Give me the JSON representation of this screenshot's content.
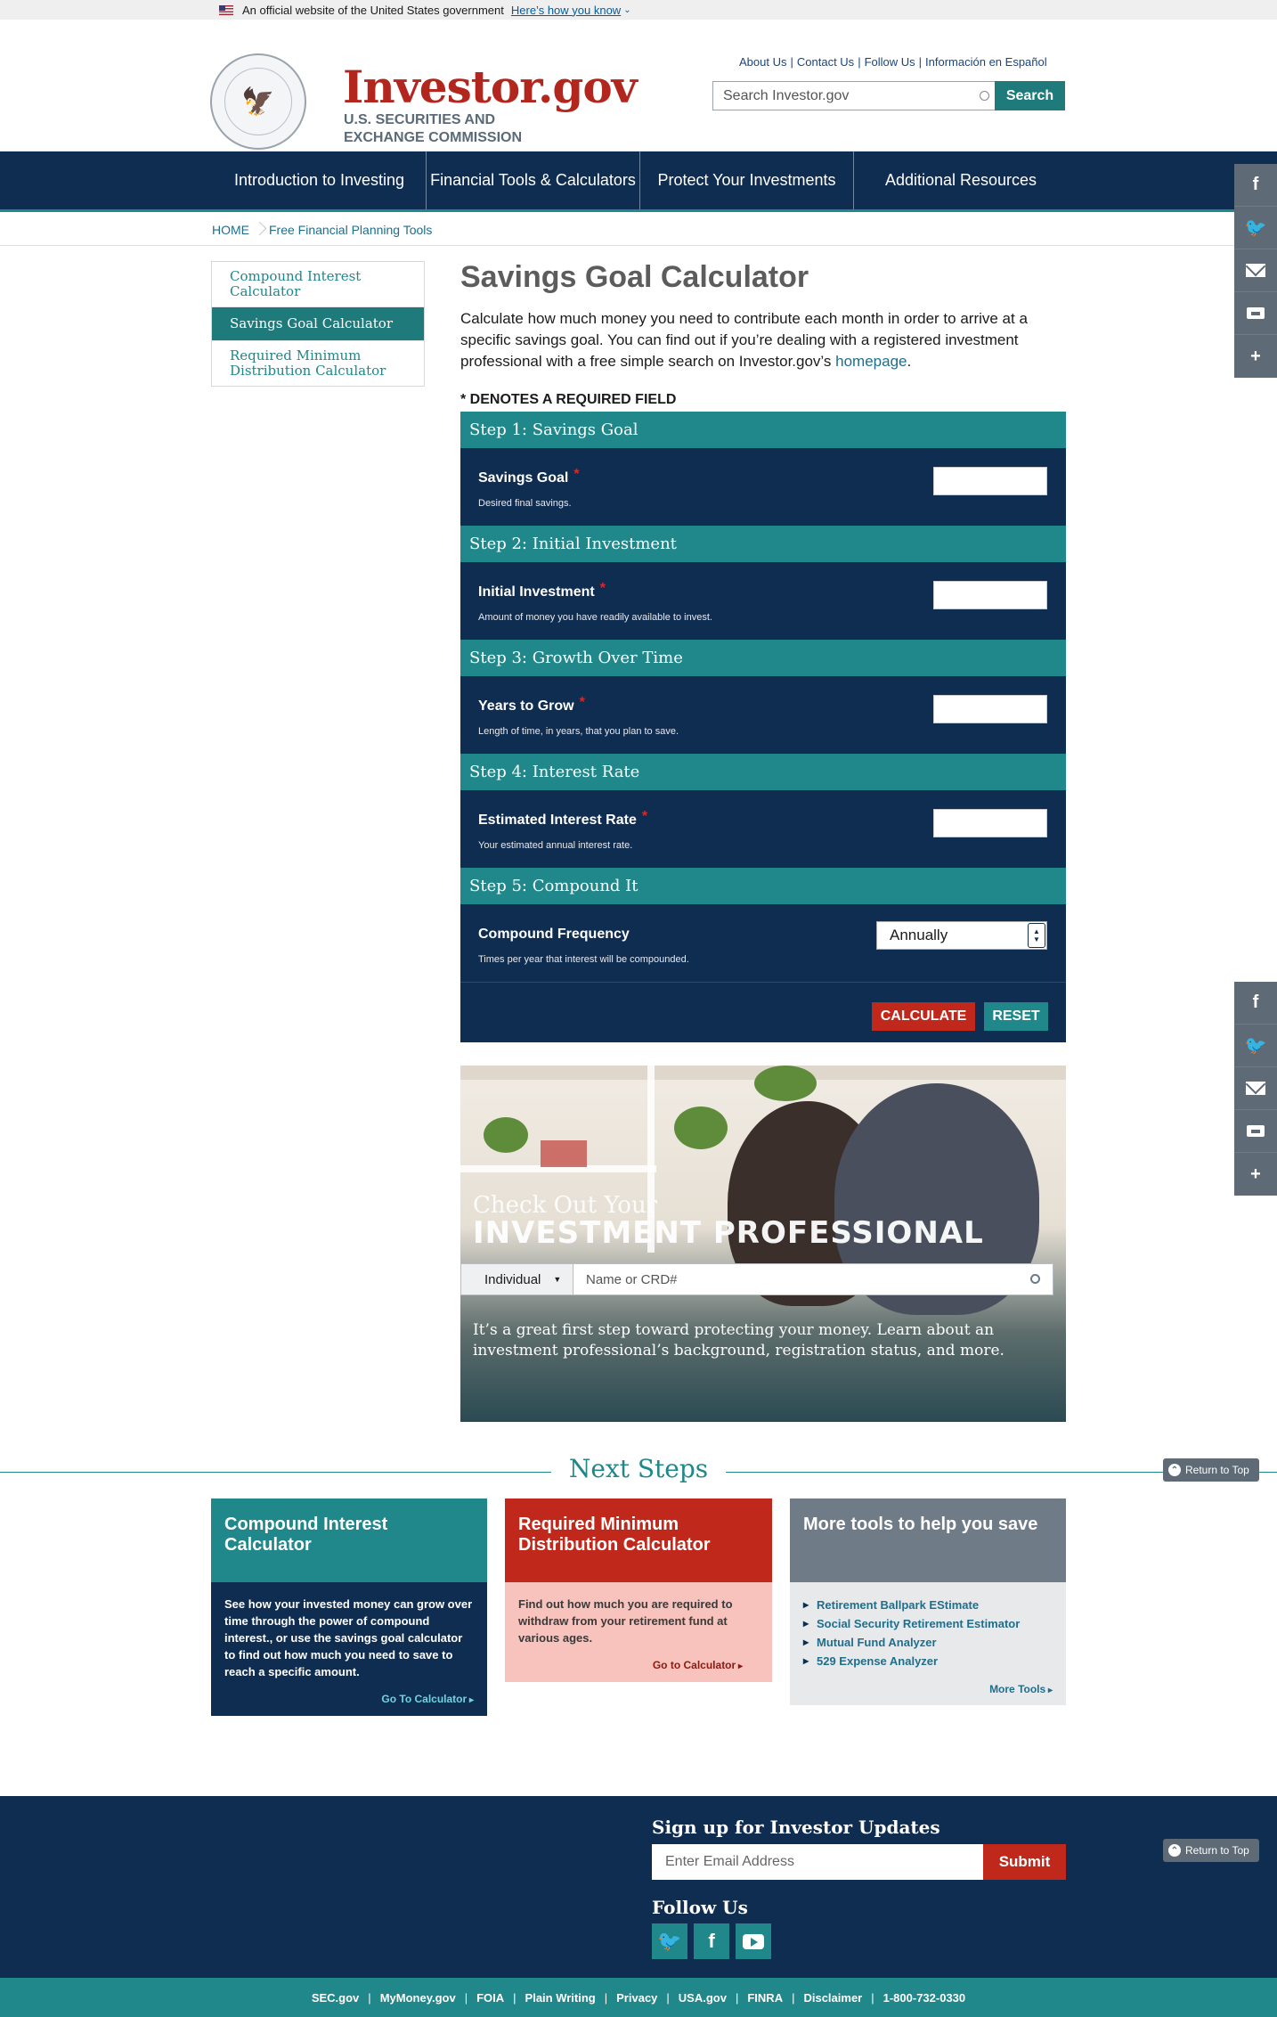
{
  "gov_banner": {
    "text": "An official website of the United States government",
    "link": "Here’s how you know"
  },
  "header": {
    "logo_title": "Investor.gov",
    "logo_subtitle": "U.S. SECURITIES AND EXCHANGE COMMISSION",
    "util_links": [
      "About Us",
      "Contact Us",
      "Follow Us",
      "Información en Español"
    ],
    "search_placeholder": "Search Investor.gov",
    "search_button": "Search"
  },
  "nav": [
    "Introduction to Investing",
    "Financial Tools & Calculators",
    "Protect Your Investments",
    "Additional Resources"
  ],
  "breadcrumb": [
    "HOME",
    "Free Financial Planning Tools"
  ],
  "sidebar": [
    "Compound Interest Calculator",
    "Savings Goal Calculator",
    "Required Minimum Distribution Calculator"
  ],
  "main": {
    "title": "Savings Goal Calculator",
    "intro": "Calculate how much money you need to contribute each month in order to arrive at a specific savings goal. You can find out if you’re dealing with a registered investment professional with a free simple search on Investor.gov’s",
    "intro_link": "homepage",
    "intro_end": ".",
    "required_note": "* DENOTES A REQUIRED FIELD"
  },
  "steps": [
    {
      "heading": "Step 1: Savings Goal",
      "label": "Savings Goal",
      "help": "Desired final savings.",
      "value": ""
    },
    {
      "heading": "Step 2: Initial Investment",
      "label": "Initial Investment",
      "help": "Amount of money you have readily available to invest.",
      "value": ""
    },
    {
      "heading": "Step 3: Growth Over Time",
      "label": "Years to Grow",
      "help": "Length of time, in years, that you plan to save.",
      "value": ""
    },
    {
      "heading": "Step 4: Interest Rate",
      "label": "Estimated Interest Rate",
      "help": "Your estimated annual interest rate.",
      "value": ""
    },
    {
      "heading": "Step 5: Compound It",
      "label": "Compound Frequency",
      "help": "Times per year that interest will be compounded.",
      "selected": "Annually"
    }
  ],
  "buttons": {
    "calculate": "CALCULATE",
    "reset": "RESET"
  },
  "promo": {
    "small_title": "Check Out Your",
    "big_title": "INVESTMENT PROFESSIONAL",
    "select": "Individual",
    "input_placeholder": "Name or CRD#",
    "text": "It’s a great first step toward protecting your money. Learn about an investment professional’s background, registration status, and more."
  },
  "next_steps": {
    "title": "Next Steps",
    "return_to_top": "Return to Top",
    "cards": [
      {
        "title": "Compound Interest Calculator",
        "body": "See how your invested money can grow over time through the power of compound interest., or use the savings goal calculator to find out how much you need to save to reach a specific amount.",
        "link": "Go To Calculator"
      },
      {
        "title": "Required Minimum Distribution Calculator",
        "body": "Find out how much you are required to withdraw from your retirement fund at various ages.",
        "link": "Go to Calculator"
      },
      {
        "title": "More tools to help you save",
        "items": [
          "Retirement Ballpark EStimate",
          "Social Security Retirement Estimator",
          "Mutual Fund Analyzer",
          "529 Expense Analyzer"
        ],
        "link": "More Tools"
      }
    ]
  },
  "footer": {
    "signup_title": "Sign up for Investor Updates",
    "email_placeholder": "Enter Email Address",
    "submit": "Submit",
    "follow_title": "Follow Us",
    "bottom_links": [
      "SEC.gov",
      "MyMoney.gov",
      "FOIA",
      "Plain Writing",
      "Privacy",
      "USA.gov",
      "FINRA",
      "Disclaimer",
      "1-800-732-0330"
    ]
  },
  "colors": {
    "navy": "#0f2c51",
    "teal": "#20878a",
    "red": "#c1281c",
    "gray": "#5e6a75"
  }
}
